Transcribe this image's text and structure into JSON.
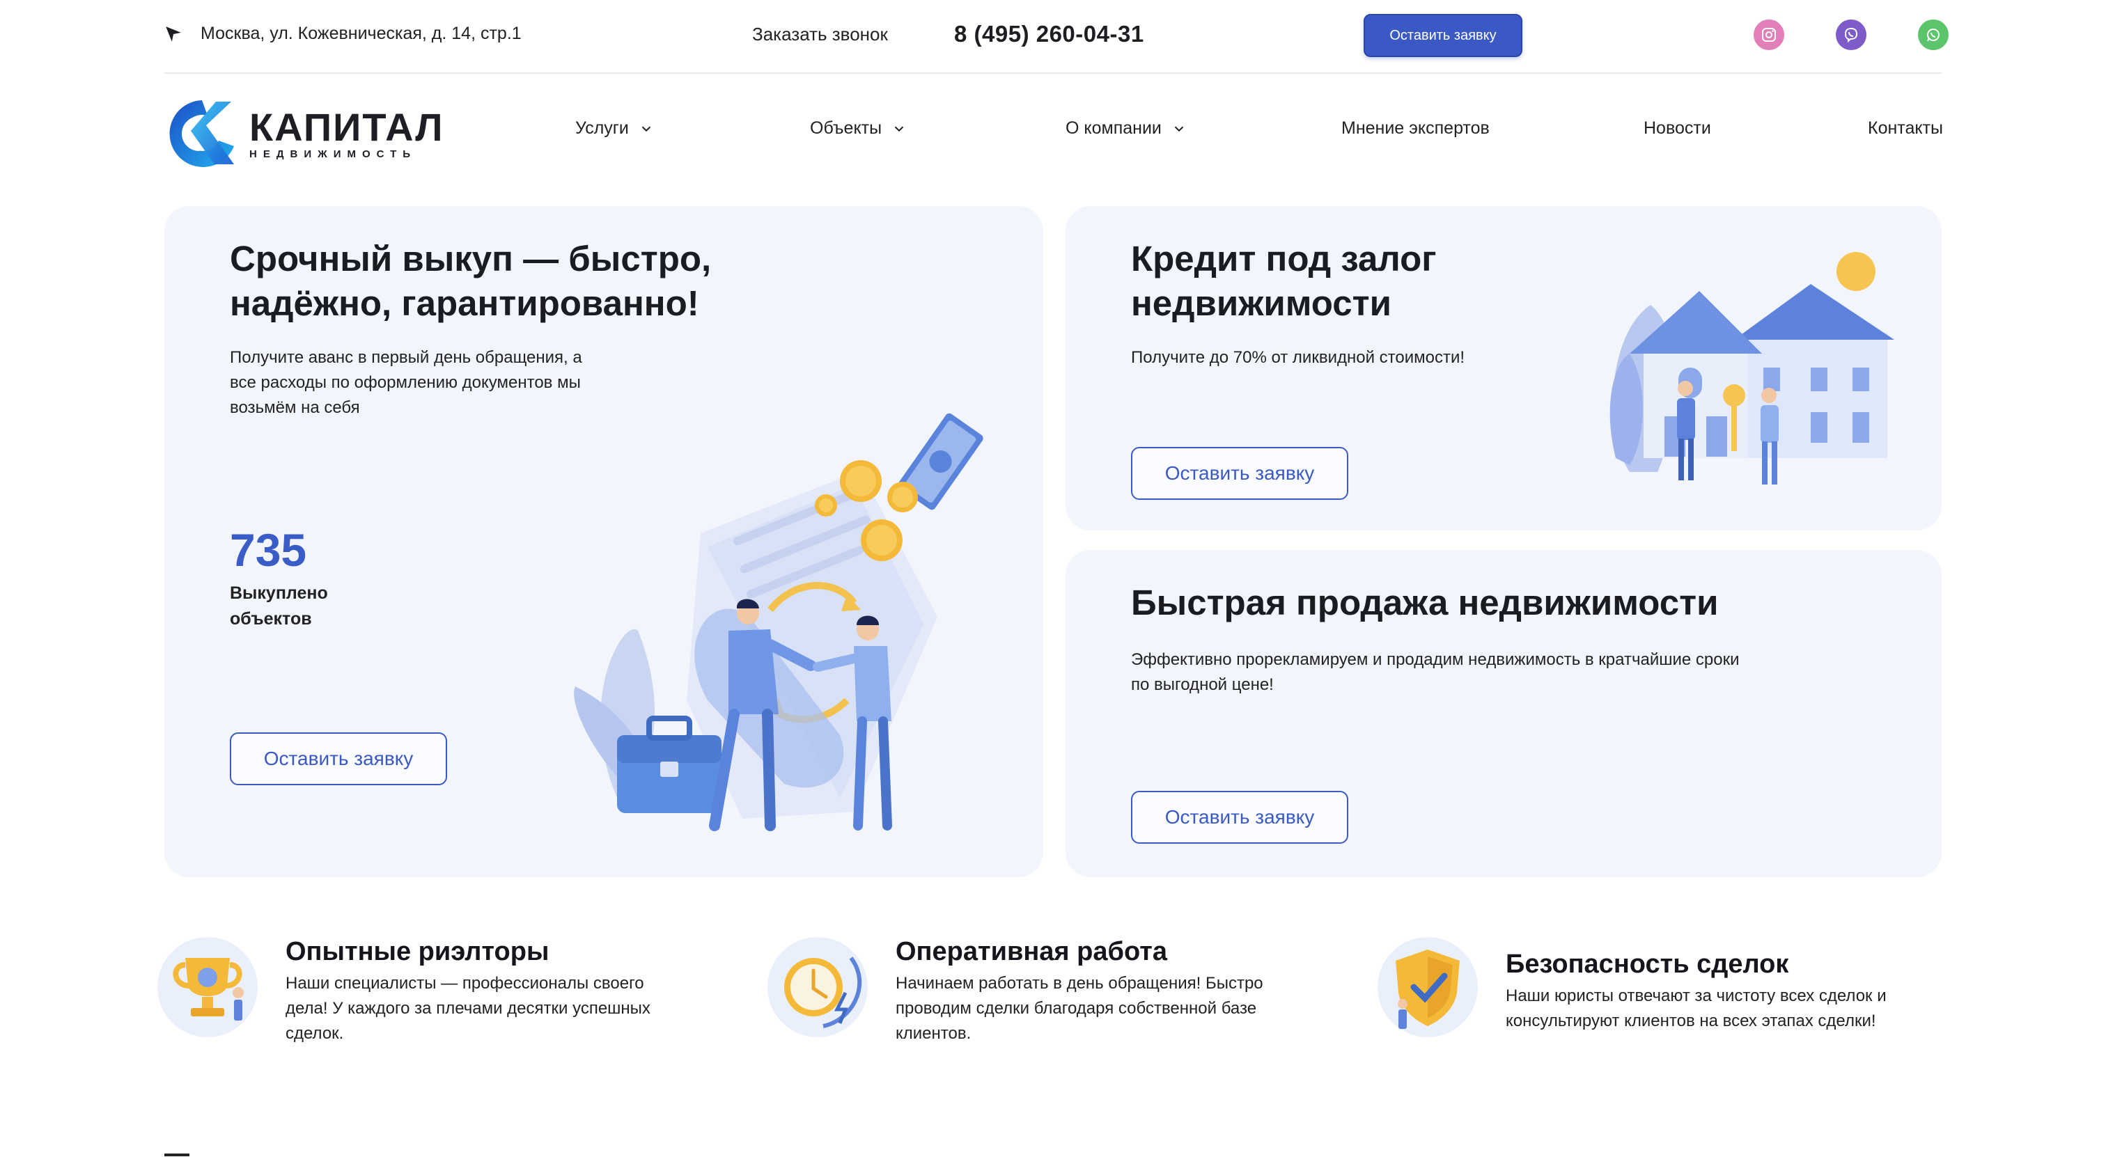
{
  "topbar": {
    "address": "Москва,  ул. Кожевническая, д. 14, стр.1",
    "callback": "Заказать звонок",
    "phone": "8 (495) 260-04-31",
    "cta": "Оставить заявку",
    "socials": [
      "instagram-icon",
      "viber-icon",
      "whatsapp-icon"
    ]
  },
  "logo": {
    "title": "КАПИТАЛ",
    "subtitle": "НЕДВИЖИМОСТЬ"
  },
  "nav": {
    "items": [
      {
        "label": "Услуги",
        "dropdown": true
      },
      {
        "label": "Объекты",
        "dropdown": true
      },
      {
        "label": "О компании",
        "dropdown": true
      },
      {
        "label": "Мнение экспертов",
        "dropdown": false
      },
      {
        "label": "Новости",
        "dropdown": false
      },
      {
        "label": "Контакты",
        "dropdown": false
      }
    ]
  },
  "cards": {
    "buyout": {
      "title_line1": "Срочный выкуп — быстро,",
      "title_line2": "надёжно, гарантированно!",
      "desc_line1": "Получите аванс в первый день обращения, а",
      "desc_line2": "все расходы по оформлению документов мы",
      "desc_line3": "возьмём на себя",
      "stat_value": "735",
      "stat_label_line1": "Выкуплено",
      "stat_label_line2": "объектов",
      "button": "Оставить заявку"
    },
    "credit": {
      "title_line1": "Кредит под залог",
      "title_line2": "недвижимости",
      "desc": "Получите до 70% от ликвидной стоимости!",
      "button": "Оставить заявку"
    },
    "sale": {
      "title": "Быстрая продажа недвижимости",
      "desc_line1": "Эффективно прорекламируем и продадим недвижимость в кратчайшие сроки",
      "desc_line2": "по выгодной цене!",
      "button": "Оставить заявку"
    }
  },
  "features": [
    {
      "title": "Опытные риэлторы",
      "desc_line1": "Наши специалисты — профессионалы своего",
      "desc_line2": "дела! У каждого за плечами десятки успешных",
      "desc_line3": "сделок.",
      "icon": "trophy-icon"
    },
    {
      "title": "Оперативная работа",
      "desc_line1": "Начинаем работать в день обращения! Быстро",
      "desc_line2": "проводим сделки благодаря собственной базе",
      "desc_line3": "клиентов.",
      "icon": "clock-icon"
    },
    {
      "title": "Безопасность сделок",
      "desc_line1": "Наши юристы отвечают за чистоту всех сделок и",
      "desc_line2": "консультируют клиентов на всех этапах сделки!",
      "icon": "shield-check-icon"
    }
  ],
  "colors": {
    "accent": "#3a59c4",
    "card_bg": "#f2f5fc",
    "stat": "#3a5cc7"
  }
}
